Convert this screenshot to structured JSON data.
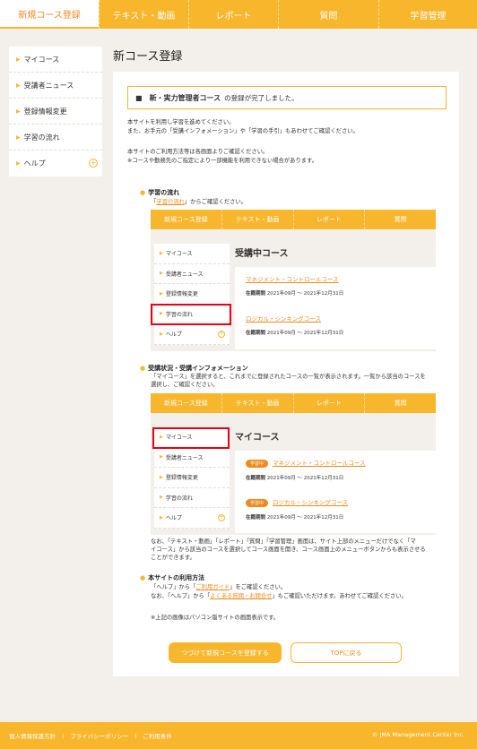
{
  "nav": {
    "tabs": [
      "新規コース登録",
      "テキスト・動画",
      "レポート",
      "質問",
      "学習管理"
    ]
  },
  "sidebar": {
    "items": [
      "マイコース",
      "受講者ニュース",
      "登録情報変更",
      "学習の流れ",
      "ヘルプ"
    ],
    "plus": "⊕"
  },
  "page": {
    "title": "新コース登録"
  },
  "notice": {
    "marker": "■",
    "bold": "新・実力管理者コース",
    "text": "の登録が完了しました。"
  },
  "intro": {
    "line1": "本サイトを利用し学習を進めてください。",
    "line2": "また、お手元の「受講インフォメーション」や「学習の手引」もあわせてご確認ください。",
    "line3": "本サイトのご利用方法等は各画面よりご確認ください。",
    "line4": "※コースや勤務先のご指定により一部機能を利用できない場合があります。"
  },
  "sec1": {
    "title": "学習の流れ",
    "desc_pre": "「",
    "desc_link": "学習の流れ",
    "desc_post": "」からご確認ください。"
  },
  "mock1": {
    "nav": [
      "新規コース登録",
      "テキスト・動画",
      "レポート",
      "質問"
    ],
    "sidebar": [
      "マイコース",
      "受講者ニュース",
      "登録情報変更",
      "学習の流れ",
      "ヘルプ"
    ],
    "heading": "受講中コース",
    "courses": [
      {
        "name": "マネジメント・コントロールコース",
        "period_label": "在籍期間",
        "period": "2021年09月 〜 2021年12月31日"
      },
      {
        "name": "ロジカル・シンキングコース",
        "period_label": "在籍期間",
        "period": "2021年09月 〜 2021年12月31日"
      }
    ]
  },
  "sec2": {
    "title": "受講状況・受講インフォメーション",
    "desc1": "「マイコース」を選択すると、これまでに登録されたコースの一覧が表示されます。一覧から該当のコースを",
    "desc2": "選択し、ご確認ください。"
  },
  "mock2": {
    "nav": [
      "新規コース登録",
      "テキスト・動画",
      "レポート",
      "質問"
    ],
    "sidebar": [
      "マイコース",
      "受講者ニュース",
      "登録情報変更",
      "学習の流れ",
      "ヘルプ"
    ],
    "heading": "マイコース",
    "badge": "学習中",
    "courses": [
      {
        "name": "マネジメント・コントロールコース",
        "period_label": "在籍期間",
        "period": "2021年09月 〜 2021年12月31日"
      },
      {
        "name": "ロジカル・シンキングコース",
        "period_label": "在籍期間",
        "period": "2021年09月 〜 2021年12月31日"
      }
    ]
  },
  "note": {
    "line1": "なお、「テキスト・動画」「レポート」「質問」「学習管理」画面は、サイト上部のメニューだけでなく「マ",
    "line2": "イコース」から該当のコースを選択してコース画面を開き、コース画面上のメニューボタンからも表示させる",
    "line3": "ことができます。"
  },
  "sec3": {
    "title": "本サイトの利用方法",
    "l1_pre": "「ヘルプ」から「",
    "l1_link": "ご利用ガイド",
    "l1_post": "」をご確認ください。",
    "l2_pre": "なお、「ヘルプ」から「",
    "l2_link": "よくある質問・お問合せ",
    "l2_post": "」もご確認いただけます。あわせてご確認ください。"
  },
  "footnote": "※上記の画像はパソコン版サイトの画面表示です。",
  "buttons": {
    "continue": "つづけて新規コースを登録する",
    "top": "TOPに戻る"
  },
  "footer": {
    "links": [
      "個人情報保護方針",
      "プライバシーポリシー",
      "ご利用条件"
    ],
    "sep": "|",
    "copyright": "© JMA Management Center Inc."
  },
  "colors": {
    "accent": "#f8b62d",
    "link": "#f08a1c",
    "highlight": "#e60012"
  }
}
